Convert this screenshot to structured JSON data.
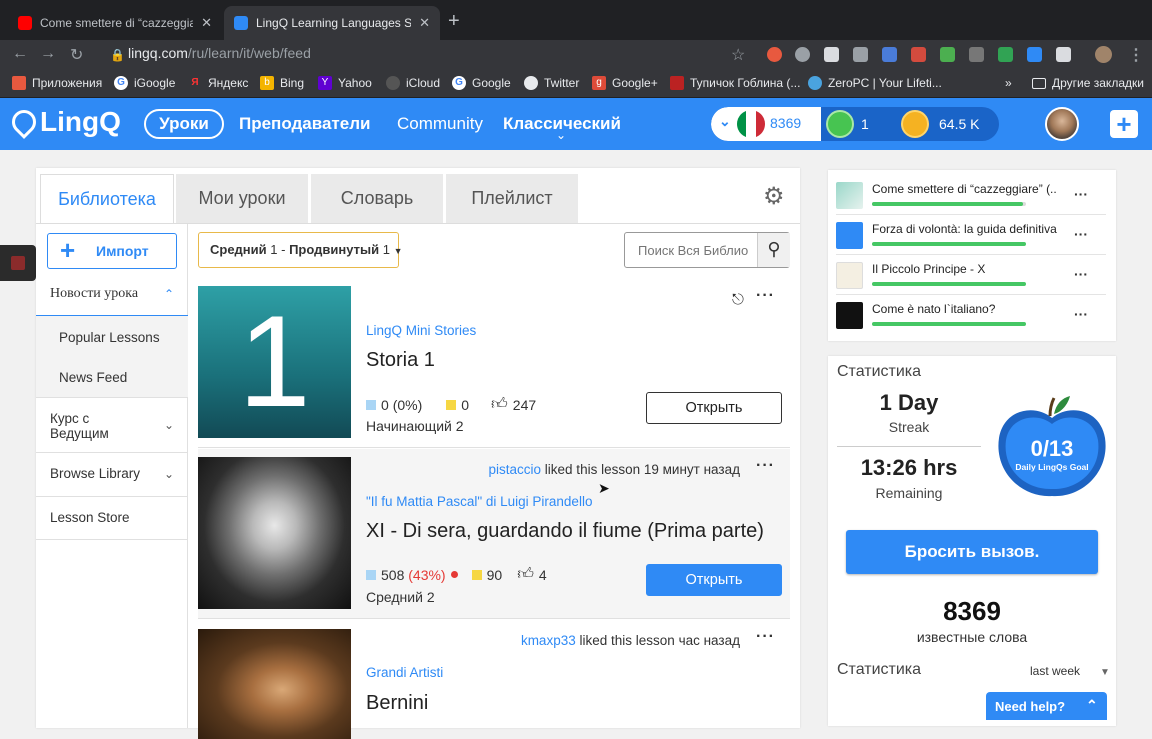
{
  "browser": {
    "tabs": [
      {
        "title": "Come smettere di “cazzeggiare”",
        "close": "✕"
      },
      {
        "title": "LingQ Learning Languages Simp",
        "close": "✕"
      }
    ],
    "new_tab": "+",
    "url_domain": "lingq.com",
    "url_path": "/ru/learn/it/web/feed",
    "bookmarks": [
      "Приложения",
      "iGoogle",
      "Яндекс",
      "Bing",
      "Yahoo",
      "iCloud",
      "Google",
      "Twitter",
      "Google+",
      "Тупичок Гоблина (...",
      "ZeroPC | Your Lifeti..."
    ],
    "bookmarks_more": "»",
    "other_bookmarks": "Другие закладки"
  },
  "header": {
    "logo": "LingQ",
    "nav": [
      "Уроки",
      "Преподаватели",
      "Community",
      "Классический"
    ],
    "known_words": "8369",
    "lingqs": "1",
    "coins": "64.5 K",
    "plus": "+"
  },
  "main": {
    "tabs": [
      "Библиотека",
      "Мои уроки",
      "Словарь",
      "Плейлист"
    ],
    "import_label": "Импорт",
    "level_filter": {
      "from_label": "Средний",
      "from_num": "1",
      "sep": " - ",
      "to_label": "Продвинутый",
      "to_num": "1"
    },
    "search_placeholder": "Поиск Вся Библио",
    "left_menu": {
      "news_lesson": "Новости урока",
      "popular": "Popular Lessons",
      "news_feed": "News Feed",
      "course": "Курс с Ведущим",
      "browse": "Browse Library",
      "store": "Lesson Store"
    },
    "lessons": [
      {
        "thumb_text": "1",
        "course": "LingQ Mini Stories",
        "title": "Storia 1",
        "known": "0",
        "pct": "(0%)",
        "lingqs": "0",
        "likes": "247",
        "level_label": "Начинающий",
        "level_num": "2",
        "open": "Открыть"
      },
      {
        "user": "pistaccio",
        "liked_text": "liked this lesson",
        "time": "19 минут назад",
        "course": "\"Il fu Mattia Pascal\" di Luigi Pirandello",
        "title": "XI - Di sera, guardando il fiume (Prima parte)",
        "known": "508",
        "pct": "(43%)",
        "lingqs": "90",
        "likes": "4",
        "level_label": "Средний",
        "level_num": "2",
        "open": "Открыть"
      },
      {
        "user": "kmaxp33",
        "liked_text": "liked this lesson",
        "time": "час назад",
        "course": "Grandi Artisti",
        "title": "Bernini"
      }
    ]
  },
  "sidebar": {
    "recent": [
      {
        "title": "Come smettere di “cazzeggiare” (...",
        "progress": 0.98
      },
      {
        "title": "Forza di volontà: la guida definitiva...",
        "progress": 1.0
      },
      {
        "title": "Il Piccolo Principe - X",
        "progress": 1.0
      },
      {
        "title": "Come è nato l`italiano?",
        "progress": 1.0
      }
    ],
    "stats_title": "Статистика",
    "streak_value": "1 Day",
    "streak_label": "Streak",
    "time_value": "13:26 hrs",
    "time_label": "Remaining",
    "goal_value": "0/13",
    "goal_label": "Daily LingQs Goal",
    "challenge": "Бросить вызов.",
    "known_count": "8369",
    "known_label": "известные слова",
    "stats_title2": "Статистика",
    "period": "last week",
    "help": "Need help?"
  },
  "colors": {
    "accent": "#2f8af5",
    "progress": "#45c764",
    "danger": "#e53935",
    "lingq_yellow": "#f6d743",
    "known_blue": "#a9d5f5"
  }
}
